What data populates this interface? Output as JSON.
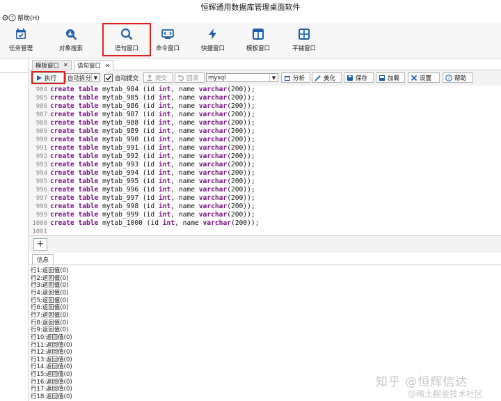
{
  "window": {
    "title": "恒辉通用数据库管理桌面软件"
  },
  "menu": {
    "help_label": "帮助(H)"
  },
  "toolbar": {
    "buttons": [
      {
        "label": "任务管理",
        "icon": "calendar-check-icon"
      },
      {
        "label": "对象搜索",
        "icon": "object-search-icon"
      },
      {
        "label": "语句窗口",
        "icon": "magnifier-icon"
      },
      {
        "label": "命令窗口",
        "icon": "terminal-icon"
      },
      {
        "label": "快捷窗口",
        "icon": "lightning-icon"
      },
      {
        "label": "模板窗口",
        "icon": "two-pane-icon"
      },
      {
        "label": "平铺窗口",
        "icon": "four-pane-icon"
      }
    ]
  },
  "tabs": [
    {
      "label": "模板窗口"
    },
    {
      "label": "语句窗口"
    }
  ],
  "query_toolbar": {
    "execute": "执行",
    "split": "自动拆分",
    "auto_commit": "自动提交",
    "commit": "提交",
    "rollback": "回滚",
    "db_type": "mysql",
    "analyze": "分析",
    "beautify": "美化",
    "save": "保存",
    "load": "加载",
    "settings": "设置",
    "help": "帮助"
  },
  "editor": {
    "lines": [
      {
        "n": "984",
        "id": "984"
      },
      {
        "n": "985",
        "id": "985"
      },
      {
        "n": "986",
        "id": "986"
      },
      {
        "n": "987",
        "id": "987"
      },
      {
        "n": "988",
        "id": "988"
      },
      {
        "n": "989",
        "id": "989"
      },
      {
        "n": "990",
        "id": "990"
      },
      {
        "n": "991",
        "id": "991"
      },
      {
        "n": "992",
        "id": "992"
      },
      {
        "n": "993",
        "id": "993"
      },
      {
        "n": "994",
        "id": "994"
      },
      {
        "n": "995",
        "id": "995"
      },
      {
        "n": "996",
        "id": "996"
      },
      {
        "n": "997",
        "id": "997"
      },
      {
        "n": "998",
        "id": "998"
      },
      {
        "n": "999",
        "id": "999"
      },
      {
        "n": "1000",
        "id": "1000"
      }
    ],
    "last_line_number": "1001",
    "kw_create": "create",
    "kw_table": "table",
    "table_prefix": "mytab_",
    "col_id": "(id",
    "kw_int": "int",
    "col_name": ", name",
    "kw_varchar": "varchar",
    "tail": "(200));"
  },
  "info": {
    "tab_label": "信息",
    "lines": [
      "行1:返回值(0)",
      "行2:返回值(0)",
      "行3:返回值(0)",
      "行4:返回值(0)",
      "行5:返回值(0)",
      "行6:返回值(0)",
      "行7:返回值(0)",
      "行8:返回值(0)",
      "行9:返回值(0)",
      "行10:返回值(0)",
      "行11:返回值(0)",
      "行12:返回值(0)",
      "行13:返回值(0)",
      "行14:返回值(0)",
      "行15:返回值(0)",
      "行16:返回值(0)",
      "行17:返回值(0)",
      "行18:返回值(0)"
    ]
  },
  "watermark": {
    "line1": "知乎 @恒辉信达",
    "line2": "@稀土掘金技术社区"
  },
  "colors": {
    "keyword": "#7a0f84",
    "accent": "#1f5fa8",
    "highlight": "#e02020"
  }
}
